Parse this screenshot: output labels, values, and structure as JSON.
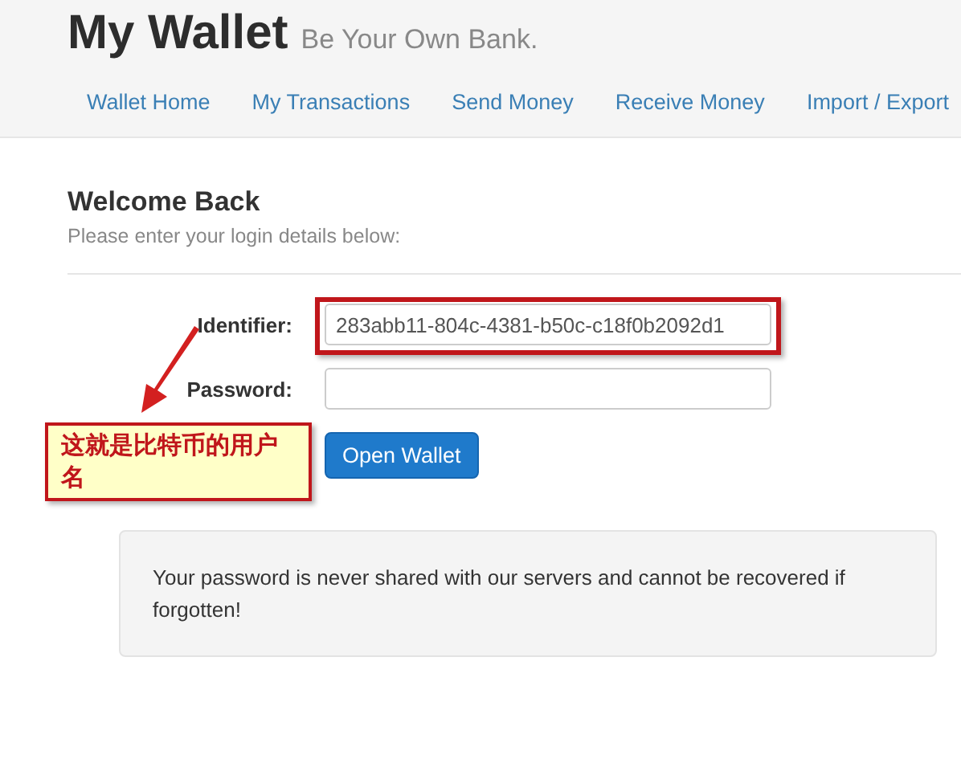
{
  "header": {
    "title": "My Wallet",
    "tagline": "Be Your Own Bank."
  },
  "nav": [
    {
      "label": "Wallet Home"
    },
    {
      "label": "My Transactions"
    },
    {
      "label": "Send Money"
    },
    {
      "label": "Receive Money"
    },
    {
      "label": "Import / Export"
    }
  ],
  "login": {
    "heading": "Welcome Back",
    "subheading": "Please enter your login details below:",
    "fields": [
      {
        "label": "Identifier:",
        "value": "283abb11-804c-4381-b50c-c18f0b2092d1",
        "highlighted": true
      },
      {
        "label": "Password:",
        "highlighted": false
      }
    ],
    "button": "Open Wallet"
  },
  "notice": "Your password is never shared with our servers and cannot be recovered if forgotten!",
  "annotation": {
    "text": "这就是比特币的用户名"
  }
}
